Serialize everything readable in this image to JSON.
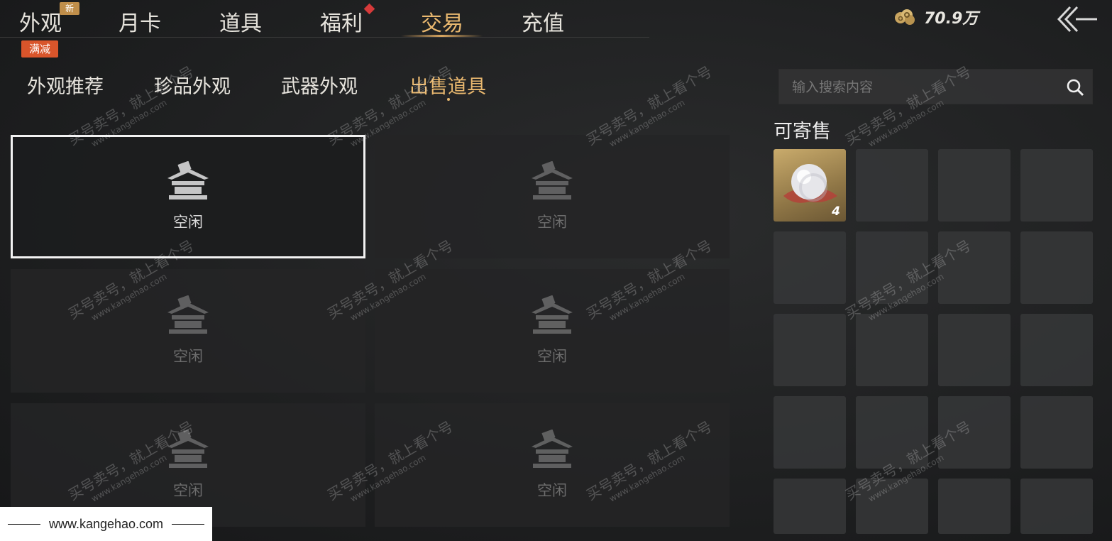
{
  "nav": {
    "tabs": [
      {
        "label": "外观"
      },
      {
        "label": "月卡"
      },
      {
        "label": "道具"
      },
      {
        "label": "福利"
      },
      {
        "label": "交易"
      },
      {
        "label": "充值"
      }
    ],
    "new_badge": "新",
    "promo_badge": "满减",
    "active_tab": "交易"
  },
  "currency": {
    "icon": "coin-cloud-icon",
    "value": "70.9万"
  },
  "subtabs": {
    "items": [
      {
        "label": "外观推荐"
      },
      {
        "label": "珍品外观"
      },
      {
        "label": "武器外观"
      },
      {
        "label": "出售道具"
      }
    ],
    "active": "出售道具"
  },
  "slots": [
    {
      "label": "空闲",
      "selected": true
    },
    {
      "label": "空闲"
    },
    {
      "label": "空闲"
    },
    {
      "label": "空闲"
    },
    {
      "label": "空闲"
    },
    {
      "label": "空闲"
    }
  ],
  "search": {
    "placeholder": "输入搜索内容"
  },
  "sellable": {
    "title": "可寄售",
    "items": [
      {
        "name": "pearl",
        "count": "4"
      }
    ]
  },
  "watermark": {
    "text": "买号卖号，就上看个号",
    "url": "www.kangehao.com",
    "sub": "看个号"
  },
  "footer": {
    "url": "www.kangehao.com"
  },
  "colors": {
    "accent": "#e9b86f",
    "promo": "#d9552b",
    "new_badge": "#bf8e4a"
  }
}
